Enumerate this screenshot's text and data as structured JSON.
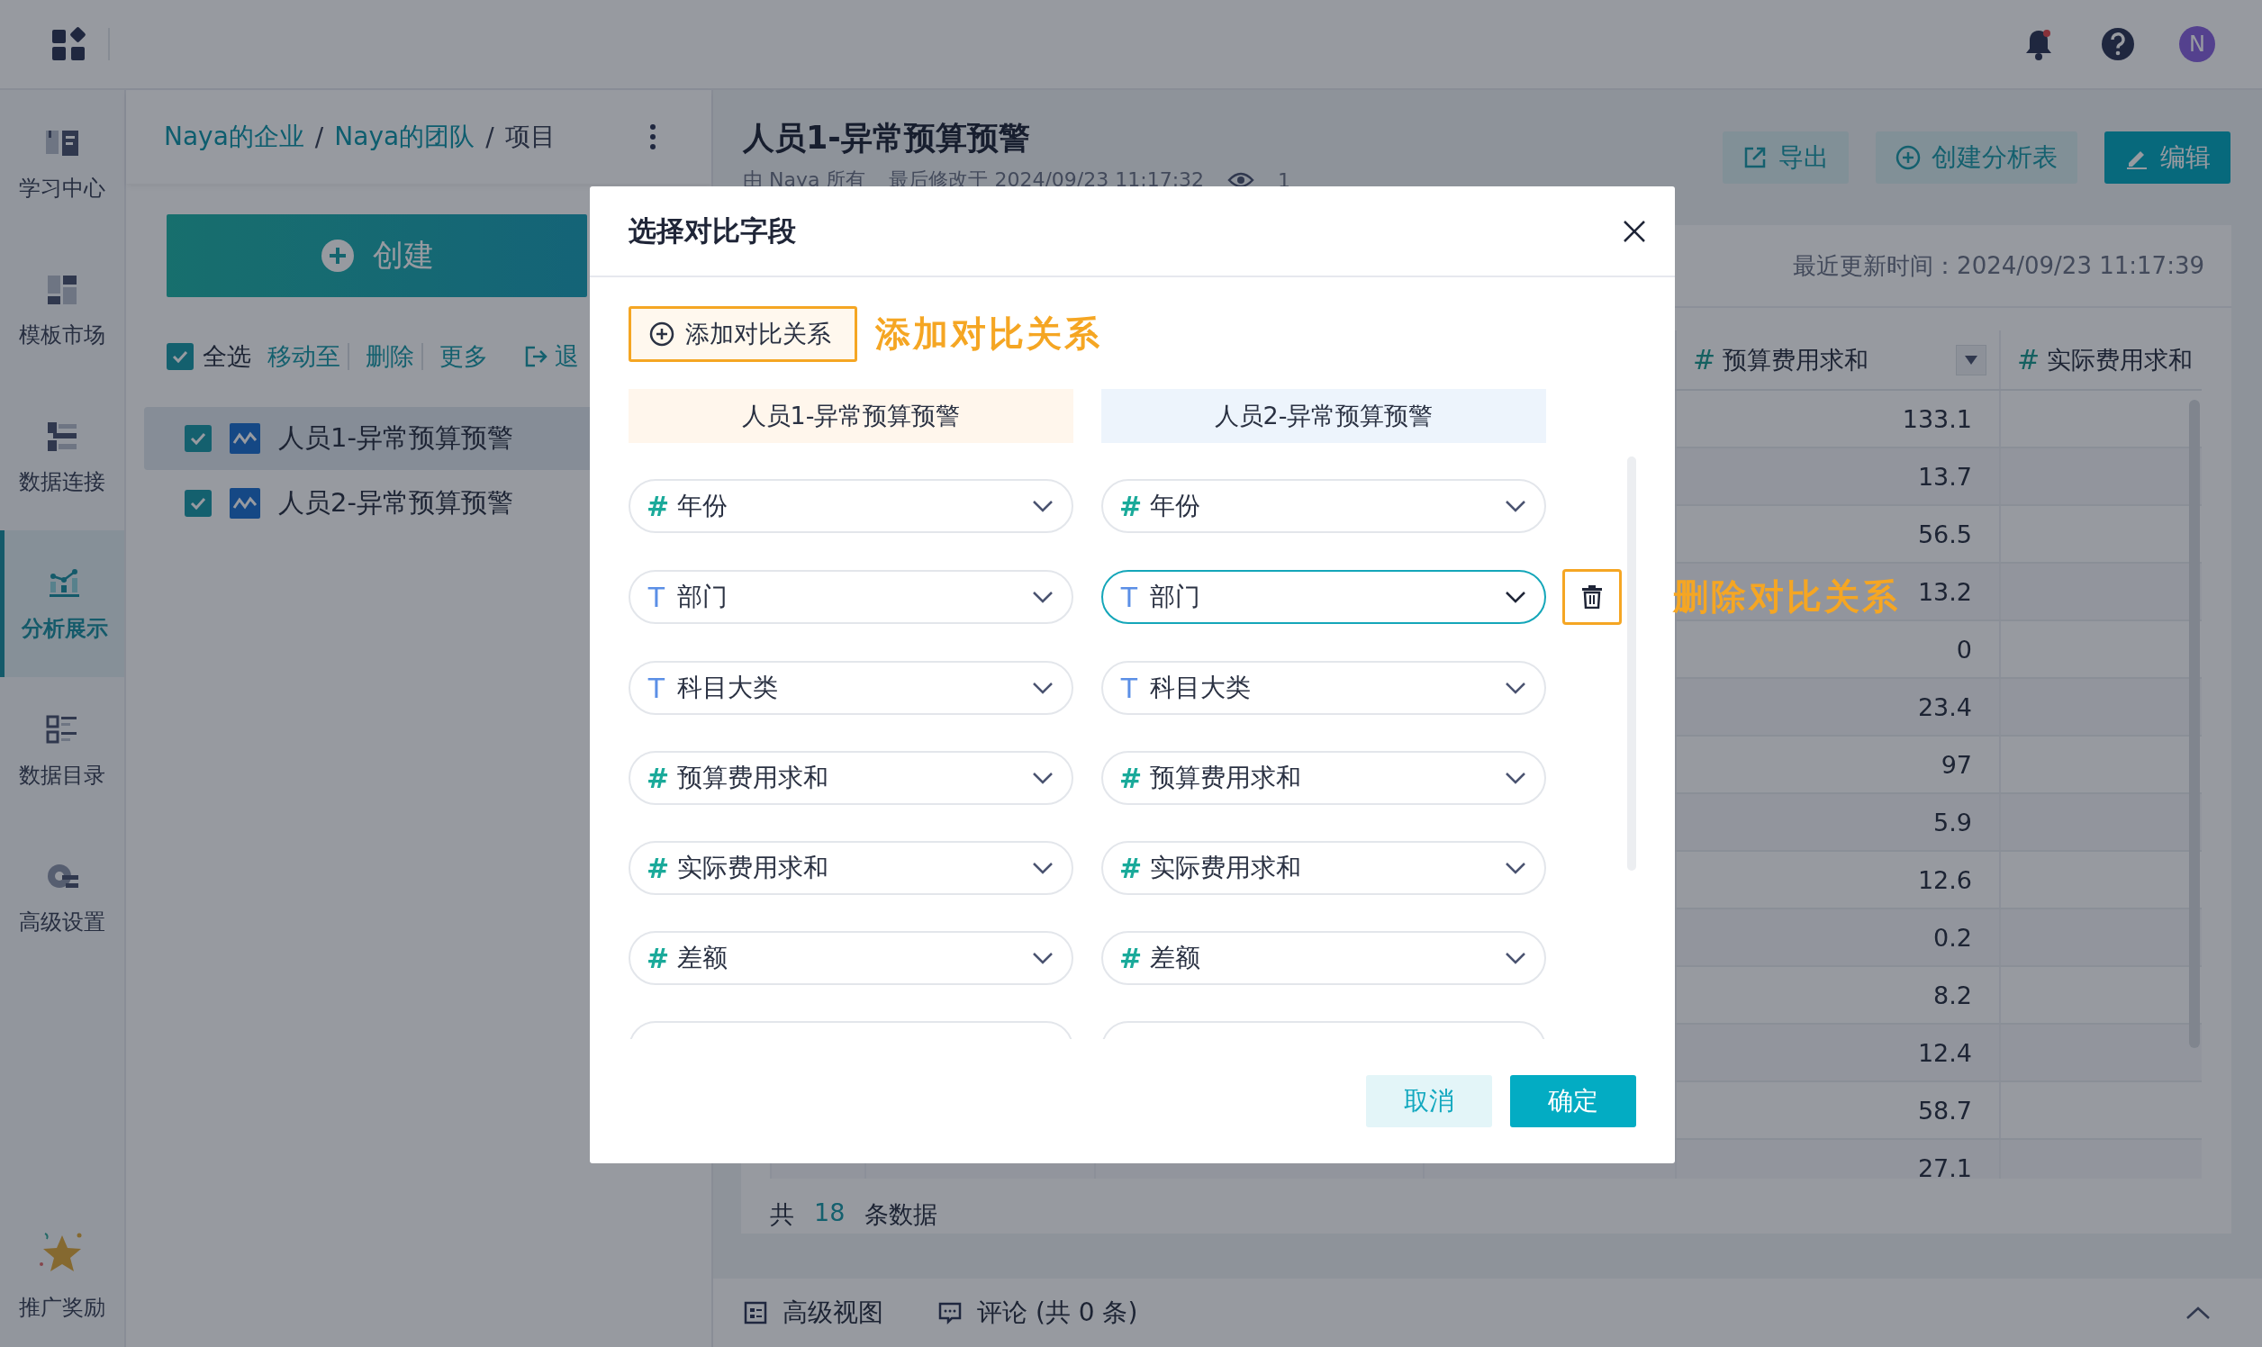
{
  "top_bar": {
    "avatar_letter": "N"
  },
  "rail": {
    "items": [
      {
        "label": "学习中心",
        "selected": false
      },
      {
        "label": "模板市场",
        "selected": false
      },
      {
        "label": "数据连接",
        "selected": false
      },
      {
        "label": "分析展示",
        "selected": true
      },
      {
        "label": "数据目录",
        "selected": false
      },
      {
        "label": "高级设置",
        "selected": false
      }
    ],
    "bottom_item": {
      "label": "推广奖励"
    }
  },
  "left_panel": {
    "breadcrumb": [
      {
        "kind": "link",
        "label": "Naya的企业"
      },
      {
        "kind": "separator",
        "label": "/"
      },
      {
        "kind": "link",
        "label": "Naya的团队"
      },
      {
        "kind": "separator",
        "label": "/"
      },
      {
        "kind": "current",
        "label": "项目"
      }
    ],
    "create_button": {
      "label": "创建"
    },
    "select_all": {
      "label": "全选",
      "checked": true
    },
    "actions": [
      {
        "kind": "link",
        "label": "移动至"
      },
      {
        "kind": "link",
        "label": "删除"
      },
      {
        "kind": "link",
        "label": "更多"
      },
      {
        "kind": "exit",
        "label": "退"
      }
    ],
    "items": [
      {
        "label": "人员1-异常预算预警",
        "checked": true,
        "selected": true
      },
      {
        "label": "人员2-异常预算预警",
        "checked": true,
        "selected": false
      }
    ]
  },
  "main": {
    "title": "人员1-异常预算预警",
    "owner": "由 Naya 所有",
    "modified": "最后修改于 2024/09/23 11:17:32",
    "views": "1",
    "actions": [
      {
        "kind": "export",
        "label": "导出"
      },
      {
        "kind": "create",
        "label": "创建分析表"
      },
      {
        "kind": "edit",
        "label": "编辑"
      }
    ],
    "updated": "最近更新时间：2024/09/23 11:17:39",
    "table": {
      "columns": [
        {
          "icon": "#",
          "label": "预算费用求和",
          "filter": true
        },
        {
          "icon": "#",
          "label": "实际费用求和",
          "filter": false
        }
      ],
      "rows": [
        {
          "budget": "133.1"
        },
        {
          "budget": "13.7"
        },
        {
          "budget": "56.5"
        },
        {
          "budget": "13.2"
        },
        {
          "budget": "0"
        },
        {
          "budget": "23.4"
        },
        {
          "budget": "97"
        },
        {
          "budget": "5.9"
        },
        {
          "budget": "12.6"
        },
        {
          "budget": "0.2"
        },
        {
          "budget": "8.2"
        },
        {
          "budget": "12.4"
        },
        {
          "budget": "58.7"
        },
        {
          "budget": "27.1"
        }
      ]
    },
    "total": {
      "prefix": "共",
      "count": "18",
      "suffix": "条数据"
    }
  },
  "bottom_bar": {
    "tabs": [
      {
        "kind": "view",
        "label": "高级视图"
      },
      {
        "kind": "comment",
        "label": "评论 (共 0 条)"
      }
    ]
  },
  "modal": {
    "title": "选择对比字段",
    "add_button": {
      "label": "添加对比关系"
    },
    "annotations": [
      {
        "text": "添加对比关系"
      },
      {
        "text": "删除对比关系"
      }
    ],
    "column_headers": [
      {
        "label": "人员1-异常预算预警"
      },
      {
        "label": "人员2-异常预算预警"
      }
    ],
    "pairs": [
      {
        "left": {
          "kind": "number",
          "icon": "#",
          "label": "年份",
          "focused": false
        },
        "right": {
          "kind": "number",
          "icon": "#",
          "label": "年份",
          "focused": false
        },
        "show_delete": false
      },
      {
        "left": {
          "kind": "text",
          "icon": "T",
          "label": "部门",
          "focused": false
        },
        "right": {
          "kind": "text",
          "icon": "T",
          "label": "部门",
          "focused": true
        },
        "show_delete": true
      },
      {
        "left": {
          "kind": "text",
          "icon": "T",
          "label": "科目大类",
          "focused": false
        },
        "right": {
          "kind": "text",
          "icon": "T",
          "label": "科目大类",
          "focused": false
        },
        "show_delete": false
      },
      {
        "left": {
          "kind": "number",
          "icon": "#",
          "label": "预算费用求和",
          "focused": false
        },
        "right": {
          "kind": "number",
          "icon": "#",
          "label": "预算费用求和",
          "focused": false
        },
        "show_delete": false
      },
      {
        "left": {
          "kind": "number",
          "icon": "#",
          "label": "实际费用求和",
          "focused": false
        },
        "right": {
          "kind": "number",
          "icon": "#",
          "label": "实际费用求和",
          "focused": false
        },
        "show_delete": false
      },
      {
        "left": {
          "kind": "number",
          "icon": "#",
          "label": "差额",
          "focused": false
        },
        "right": {
          "kind": "number",
          "icon": "#",
          "label": "差额",
          "focused": false
        },
        "show_delete": false
      },
      {
        "left": {
          "focused": false
        },
        "right": {
          "focused": false
        },
        "show_delete": false
      }
    ],
    "cancel_button": {
      "label": "取消"
    },
    "ok_button": {
      "label": "确定"
    }
  }
}
